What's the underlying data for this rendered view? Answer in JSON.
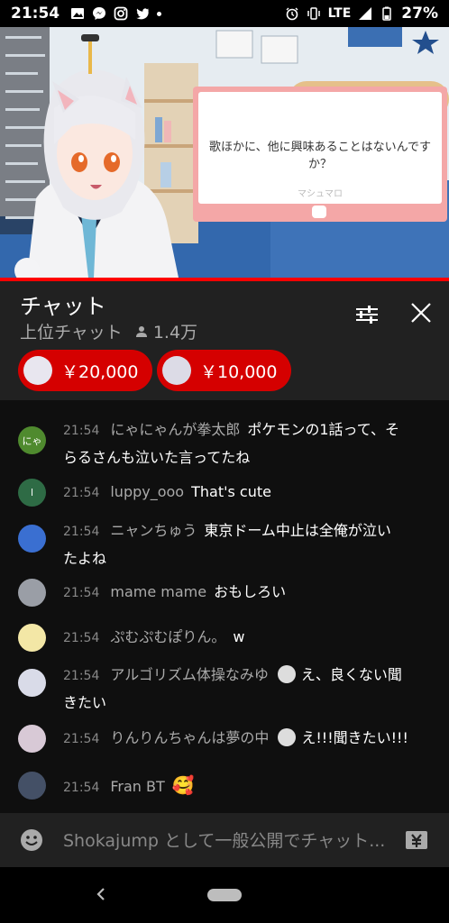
{
  "status_bar": {
    "time": "21:54",
    "network": "LTE",
    "battery": "27%"
  },
  "video": {
    "question_text": "歌ほかに、他に興味あることはないんですか？",
    "card_label": "マシュマロ"
  },
  "chat_header": {
    "title": "チャット",
    "mode": "上位チャット",
    "viewers": "1.4万",
    "superchats": [
      {
        "amount": "￥20,000"
      },
      {
        "amount": "￥10,000"
      }
    ]
  },
  "messages": [
    {
      "time": "21:54",
      "author": "にゃにゃんが拳太郎",
      "text": "ポケモンの1話って、そ",
      "text2": "らるさんも泣いた言ってたね",
      "avatar_label": "にゃ",
      "avatar_color": "#4f8a2e"
    },
    {
      "time": "21:54",
      "author": "luppy_ooo",
      "text": "That's cute",
      "avatar_label": "l",
      "avatar_color": "#2e6b45"
    },
    {
      "time": "21:54",
      "author": "ニャンちゅう",
      "text": "東京ドーム中止は全俺が泣い",
      "text2": "たよね",
      "avatar_label": "",
      "avatar_color": "#3a6fd1"
    },
    {
      "time": "21:54",
      "author": "mame mame",
      "text": "おもしろい",
      "avatar_label": "",
      "avatar_color": "#9a9ea6"
    },
    {
      "time": "21:54",
      "author": "ぷむぷむぽりん。",
      "text": "w",
      "avatar_label": "",
      "avatar_color": "#f3e7a6"
    },
    {
      "time": "21:54",
      "author": "アルゴリズム体操なみゆ",
      "text": "え、良くない聞",
      "text2": "きたい",
      "avatar_label": "",
      "avatar_color": "#d9dbe8"
    },
    {
      "time": "21:54",
      "author": "りんりんちゃんは夢の中",
      "text": "え!!!聞きたい!!!",
      "avatar_label": "",
      "avatar_color": "#d8c9d6"
    },
    {
      "time": "21:54",
      "author": "Fran BT",
      "text": "🥰",
      "avatar_label": "",
      "avatar_color": "#445066"
    }
  ],
  "input": {
    "placeholder": "Shokajump として一般公開でチャット..."
  },
  "colors": {
    "superchat_red": "#d50000",
    "progress_red": "#ff0000"
  },
  "icons": [
    "gallery-icon",
    "messenger-icon",
    "instagram-icon",
    "twitter-icon",
    "alarm-icon",
    "vibrate-icon",
    "signal-icon",
    "battery-icon",
    "filter-icon",
    "close-icon",
    "person-icon",
    "smile-icon",
    "superchat-icon",
    "back-icon",
    "home-icon"
  ]
}
